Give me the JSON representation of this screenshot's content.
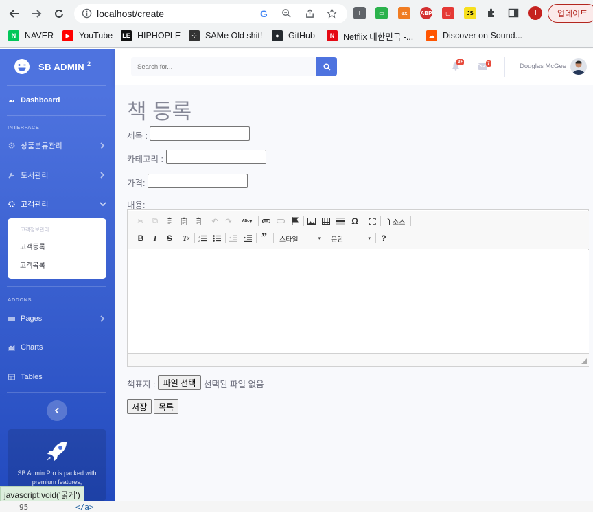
{
  "browser": {
    "url": "localhost/create",
    "update_label": "업데이트",
    "profile_initial": "I",
    "bookmarks": [
      {
        "label": "NAVER",
        "icon": "naver-icon",
        "color": "#03c75a",
        "glyph": "N"
      },
      {
        "label": "YouTube",
        "icon": "youtube-icon",
        "color": "#ff0000",
        "glyph": "▶"
      },
      {
        "label": "HIPHOPLE",
        "icon": "hiphople-icon",
        "color": "#111111",
        "glyph": "LE"
      },
      {
        "label": "SAMe Old shit!",
        "icon": "dots-icon",
        "color": "#333333",
        "glyph": "⁘"
      },
      {
        "label": "GitHub",
        "icon": "github-icon",
        "color": "#24292e",
        "glyph": "●"
      },
      {
        "label": "Netflix 대한민국 -...",
        "icon": "netflix-icon",
        "color": "#e50914",
        "glyph": "N"
      },
      {
        "label": "Discover on Sound...",
        "icon": "soundcloud-icon",
        "color": "#ff5500",
        "glyph": "☁"
      }
    ]
  },
  "sidebar": {
    "brand": "SB ADMIN",
    "brand_sup": "2",
    "dashboard": "Dashboard",
    "heading_interface": "INTERFACE",
    "items": [
      {
        "label": "상품분류관리"
      },
      {
        "label": "도서관리"
      },
      {
        "label": "고객관리"
      }
    ],
    "sub_heading": "고객정보관리:",
    "sub_items": [
      "고객등록",
      "고객목록"
    ],
    "heading_addons": "ADDONS",
    "addons": [
      {
        "label": "Pages"
      },
      {
        "label": "Charts"
      },
      {
        "label": "Tables"
      }
    ],
    "promo_line1": "SB Admin Pro is packed with",
    "promo_line2": "premium features,"
  },
  "topbar": {
    "search_placeholder": "Search for...",
    "alerts_count": "3+",
    "messages_count": "7",
    "user_name": "Douglas McGee"
  },
  "form": {
    "title": "책 등록",
    "field_title": "제목 :",
    "field_category": "카테고리 :",
    "field_price": "가격:",
    "field_content": "내용:",
    "style_combo": "스타일",
    "format_combo": "문단",
    "source_label": "소스",
    "file_label": "책표지 :",
    "file_button": "파일 선택",
    "file_status": "선택된 파일 없음",
    "save_button": "저장",
    "list_button": "목록"
  },
  "status": {
    "link_hint": "javascript:void('굵게')",
    "line_number": "95",
    "code_text": "</a>"
  },
  "colors": {
    "sidebar_top": "#4e73df",
    "sidebar_bottom": "#224abe",
    "search_button": "#4e73df",
    "badge": "#e74a3b"
  }
}
